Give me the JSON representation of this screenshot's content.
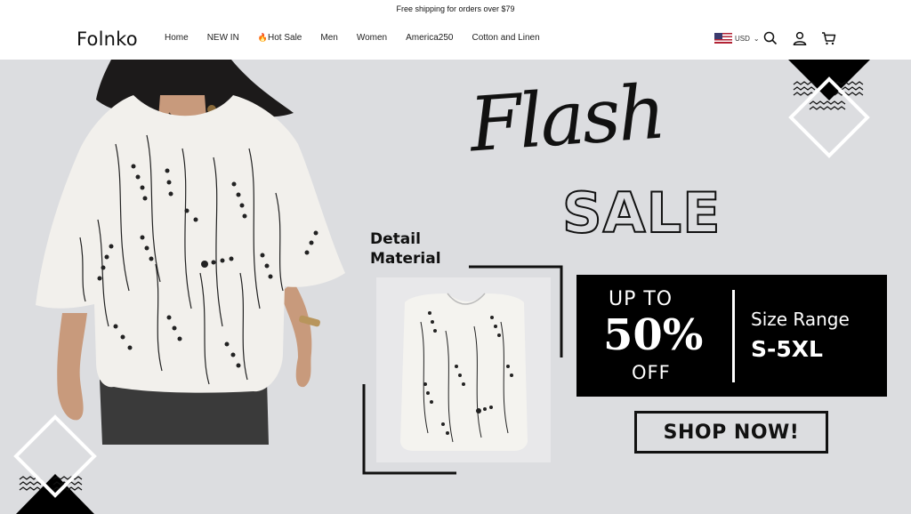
{
  "announcement": "Free shipping for orders over $79",
  "brand": {
    "logo": "Folnko"
  },
  "nav": {
    "items": [
      {
        "label": "Home"
      },
      {
        "label": "NEW IN"
      },
      {
        "label": "Hot Sale",
        "icon": "fire-icon",
        "prefix": "🔥"
      },
      {
        "label": "Men"
      },
      {
        "label": "Women"
      },
      {
        "label": "America250"
      },
      {
        "label": "Cotton and Linen"
      }
    ]
  },
  "header_tools": {
    "currency": "USD",
    "flag": "us-flag-icon",
    "icons": [
      "search-icon",
      "account-icon",
      "cart-icon"
    ]
  },
  "hero": {
    "flash_text": "Flash",
    "sale_text": "SALE",
    "detail_line1": "Detail",
    "detail_line2": "Material",
    "promo": {
      "up_to": "UP TO",
      "percent": "50%",
      "off": "OFF",
      "size_label": "Size Range",
      "size_value": "S-5XL"
    },
    "cta": "SHOP NOW!",
    "colors": {
      "background": "#dcdde0",
      "promo_bg": "#000000",
      "text": "#111111"
    }
  }
}
